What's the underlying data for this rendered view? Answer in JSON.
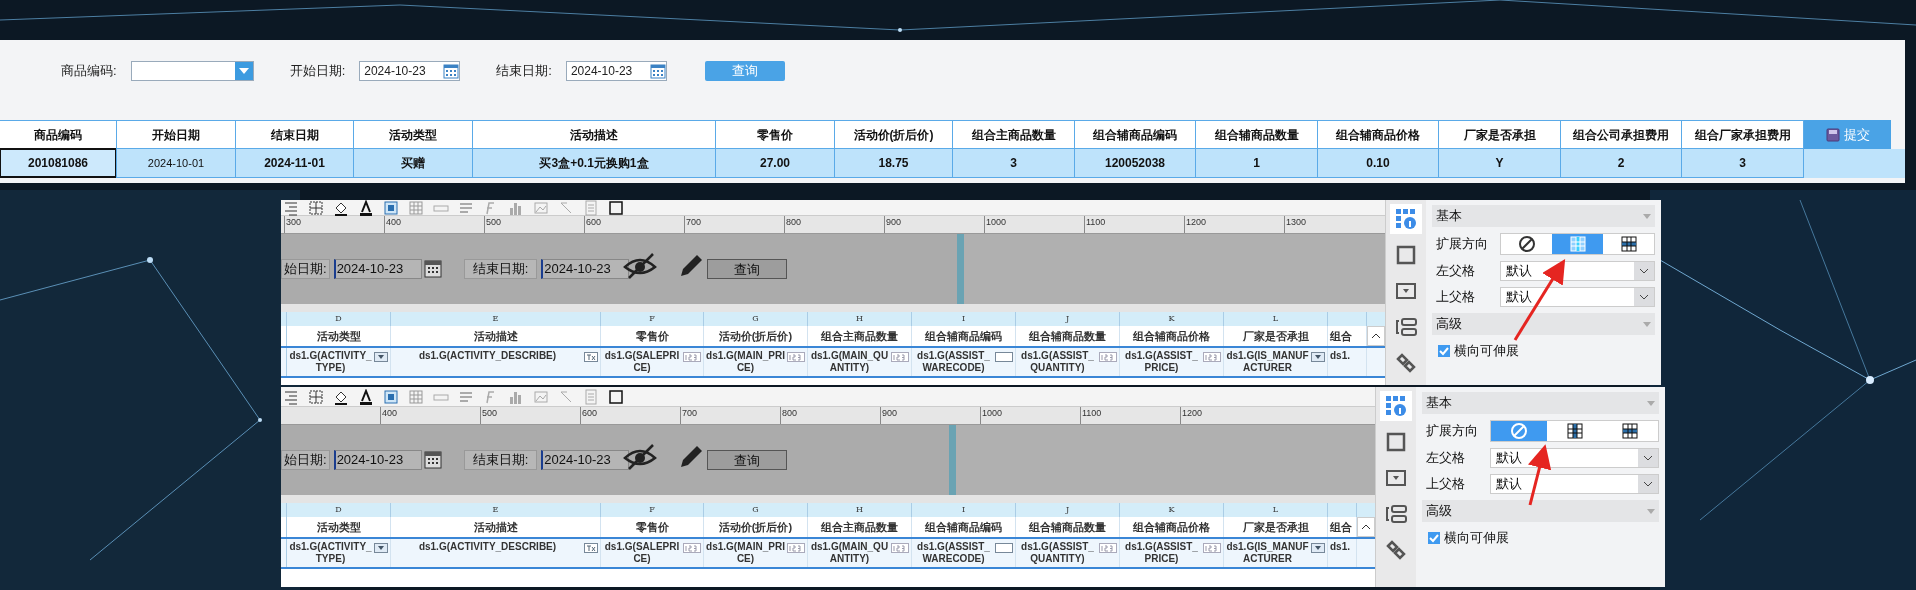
{
  "query_form": {
    "fields": [
      {
        "kind": "dropdown",
        "label": "商品编码:"
      },
      {
        "kind": "date",
        "label": "开始日期:",
        "value": "2024-10-23"
      },
      {
        "kind": "date",
        "label": "结束日期:",
        "value": "2024-10-23"
      }
    ],
    "button": "查询"
  },
  "table": {
    "columns": [
      "商品编码",
      "开始日期",
      "结束日期",
      "活动类型",
      "活动描述",
      "零售价",
      "活动价(折后价)",
      "组合主商品数量",
      "组合辅商品编码",
      "组合辅商品数量",
      "组合辅商品价格",
      "厂家是否承担",
      "组合公司承担费用",
      "组合厂家承担费用"
    ],
    "submit_button": "提交",
    "rows": [
      {
        "cells": [
          {
            "text": "201081086",
            "selected": true
          },
          {
            "text": "2024-10-01",
            "selected": false
          },
          {
            "text": "2024-11-01",
            "selected": false
          },
          {
            "text": "买赠",
            "selected": false
          },
          {
            "text": "买3盒+0.1元换购1盒",
            "selected": false
          },
          {
            "text": "27.00",
            "selected": false
          },
          {
            "text": "18.75",
            "selected": false
          },
          {
            "text": "3",
            "selected": false
          },
          {
            "text": "120052038",
            "selected": false
          },
          {
            "text": "1",
            "selected": false
          },
          {
            "text": "0.10",
            "selected": false
          },
          {
            "text": "Y",
            "selected": false
          },
          {
            "text": "2",
            "selected": false
          },
          {
            "text": "3",
            "selected": false
          }
        ]
      }
    ]
  },
  "designer_views": [
    {
      "ruler": [
        "300",
        "400",
        "500",
        "600",
        "700",
        "800",
        "900",
        "1000",
        "1100",
        "1200",
        "1300"
      ],
      "form": {
        "start_label": "始日期:",
        "start_value": "2024-10-23",
        "end_label": "结束日期:",
        "end_value": "2024-10-23",
        "button": "查询"
      },
      "grid": [
        {
          "letter": "D",
          "header": "活动类型",
          "formula": "ds1.G(ACTIVITY_TYPE)",
          "kind": "list"
        },
        {
          "letter": "E",
          "header": "活动描述",
          "formula": "ds1.G(ACTIVITY_DESCRIBE)",
          "kind": "text"
        },
        {
          "letter": "F",
          "header": "零售价",
          "formula": "ds1.G(SALEPRICE)",
          "kind": "number"
        },
        {
          "letter": "G",
          "header": "活动价(折后价)",
          "formula": "ds1.G(MAIN_PRICE)",
          "kind": "number"
        },
        {
          "letter": "H",
          "header": "组合主商品数量",
          "formula": "ds1.G(MAIN_QUANTITY)",
          "kind": "number"
        },
        {
          "letter": "I",
          "header": "组合辅商品编码",
          "formula": "ds1.G(ASSIST_WARECODE)",
          "kind": "plain"
        },
        {
          "letter": "J",
          "header": "组合辅商品数量",
          "formula": "ds1.G(ASSIST_QUANTITY)",
          "kind": "number"
        },
        {
          "letter": "K",
          "header": "组合辅商品价格",
          "formula": "ds1.G(ASSIST_PRICE)",
          "kind": "number"
        },
        {
          "letter": "L",
          "header": "厂家是否承担",
          "formula": "ds1.G(IS_MANUFACTURER",
          "kind": "list"
        },
        {
          "header": "组合",
          "formula": "ds1."
        }
      ],
      "panel": {
        "basic_section": "基本",
        "expand_label": "扩展方向",
        "expand_options": [
          {
            "kind": "none",
            "selected": false
          },
          {
            "kind": "vertical",
            "selected": true
          },
          {
            "kind": "horizontal",
            "selected": false
          }
        ],
        "left_parent": {
          "label": "左父格",
          "value": "默认"
        },
        "top_parent": {
          "label": "上父格",
          "value": "默认"
        },
        "advanced_section": "高级",
        "checkbox": {
          "label": "横向可伸展",
          "checked": true
        }
      }
    },
    {
      "ruler": [
        "400",
        "500",
        "600",
        "700",
        "800",
        "900",
        "1000",
        "1100",
        "1200"
      ],
      "form": {
        "start_label": "始日期:",
        "start_value": "2024-10-23",
        "end_label": "结束日期:",
        "end_value": "2024-10-23",
        "button": "查询"
      },
      "grid": [
        {
          "letter": "D",
          "header": "活动类型",
          "formula": "ds1.G(ACTIVITY_TYPE)",
          "kind": "list"
        },
        {
          "letter": "E",
          "header": "活动描述",
          "formula": "ds1.G(ACTIVITY_DESCRIBE)",
          "kind": "text"
        },
        {
          "letter": "F",
          "header": "零售价",
          "formula": "ds1.G(SALEPRICE)",
          "kind": "number"
        },
        {
          "letter": "G",
          "header": "活动价(折后价)",
          "formula": "ds1.G(MAIN_PRICE)",
          "kind": "number"
        },
        {
          "letter": "H",
          "header": "组合主商品数量",
          "formula": "ds1.G(MAIN_QUANTITY)",
          "kind": "number"
        },
        {
          "letter": "I",
          "header": "组合辅商品编码",
          "formula": "ds1.G(ASSIST_WARECODE)",
          "kind": "plain"
        },
        {
          "letter": "J",
          "header": "组合辅商品数量",
          "formula": "ds1.G(ASSIST_QUANTITY)",
          "kind": "number"
        },
        {
          "letter": "K",
          "header": "组合辅商品价格",
          "formula": "ds1.G(ASSIST_PRICE)",
          "kind": "number"
        },
        {
          "letter": "L",
          "header": "厂家是否承担",
          "formula": "ds1.G(IS_MANUFACTURER",
          "kind": "list"
        },
        {
          "header": "组合",
          "formula": "ds1."
        }
      ],
      "panel": {
        "basic_section": "基本",
        "expand_label": "扩展方向",
        "expand_options": [
          {
            "kind": "none",
            "selected": true
          },
          {
            "kind": "vertical",
            "selected": false
          },
          {
            "kind": "horizontal",
            "selected": false
          }
        ],
        "left_parent": {
          "label": "左父格",
          "value": "默认"
        },
        "top_parent": {
          "label": "上父格",
          "value": "默认"
        },
        "advanced_section": "高级",
        "checkbox": {
          "label": "横向可伸展",
          "checked": true
        }
      }
    }
  ]
}
